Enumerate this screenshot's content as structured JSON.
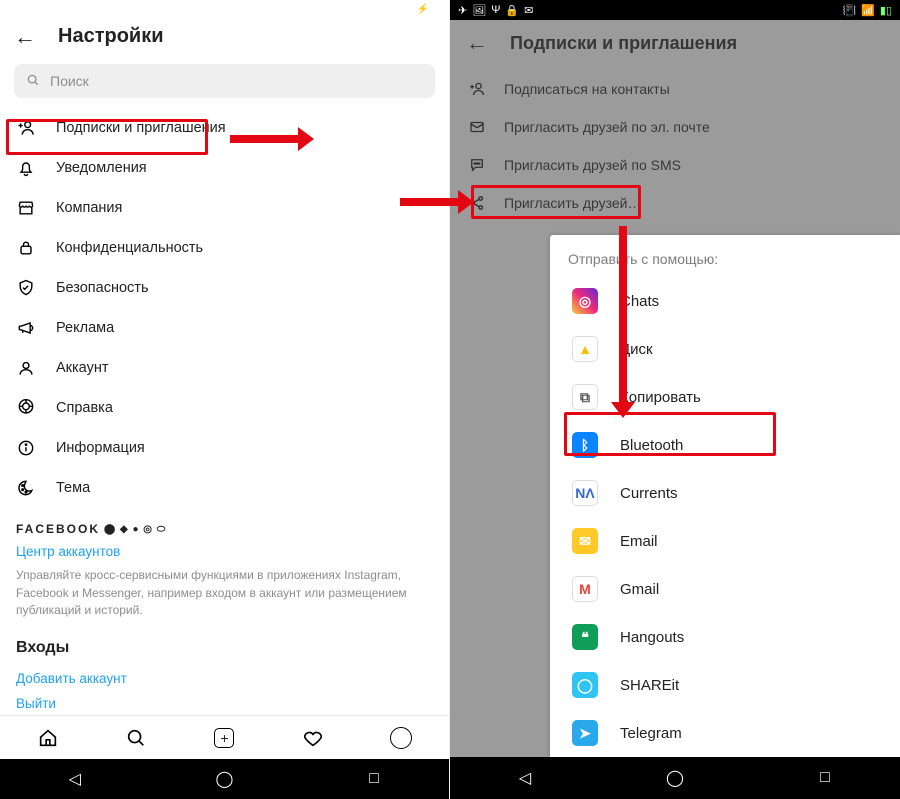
{
  "left": {
    "title": "Настройки",
    "search_placeholder": "Поиск",
    "menu": [
      {
        "icon": "add-person",
        "label": "Подписки и приглашения"
      },
      {
        "icon": "bell",
        "label": "Уведомления"
      },
      {
        "icon": "shop",
        "label": "Компания"
      },
      {
        "icon": "lock",
        "label": "Конфиденциальность"
      },
      {
        "icon": "shield",
        "label": "Безопасность"
      },
      {
        "icon": "megaphone",
        "label": "Реклама"
      },
      {
        "icon": "user",
        "label": "Аккаунт"
      },
      {
        "icon": "help",
        "label": "Справка"
      },
      {
        "icon": "info",
        "label": "Информация"
      },
      {
        "icon": "theme",
        "label": "Тема"
      }
    ],
    "facebook_label": "FACEBOOK",
    "account_center": "Центр аккаунтов",
    "account_desc": "Управляйте кросс-сервисными функциями в приложениях Instagram, Facebook и Messenger, например входом в аккаунт или размещением публикаций и историй.",
    "logins_title": "Входы",
    "add_account": "Добавить аккаунт",
    "logout": "Выйти"
  },
  "right": {
    "title": "Подписки и приглашения",
    "menu": [
      {
        "icon": "add-person",
        "label": "Подписаться на контакты"
      },
      {
        "icon": "mail",
        "label": "Пригласить друзей по эл. почте"
      },
      {
        "icon": "sms",
        "label": "Пригласить друзей по SMS"
      },
      {
        "icon": "share",
        "label": "Пригласить друзей…"
      }
    ],
    "sheet_title": "Отправить с помощью:",
    "apps": [
      {
        "name": "Chats",
        "iconbg": "linear-gradient(45deg,#f9ce34,#ee2a7b,#6228d7)",
        "sym": "◎"
      },
      {
        "name": "Диск",
        "iconbg": "#fff",
        "sym": "▲",
        "symcolor": "#fbbd05",
        "border": "1px solid #ddd"
      },
      {
        "name": "Копировать",
        "iconbg": "#fff",
        "sym": "⧉",
        "symcolor": "#555",
        "border": "1px solid #ddd"
      },
      {
        "name": "Bluetooth",
        "iconbg": "#0a84ff",
        "sym": "ᛒ"
      },
      {
        "name": "Currents",
        "iconbg": "#fff",
        "sym": "ΝΛ",
        "symcolor": "#3367d6",
        "border": "1px solid #ddd"
      },
      {
        "name": "Email",
        "iconbg": "#ffca28",
        "sym": "✉",
        "symcolor": "#fff"
      },
      {
        "name": "Gmail",
        "iconbg": "#fff",
        "sym": "M",
        "symcolor": "#ea4335",
        "border": "1px solid #ddd"
      },
      {
        "name": "Hangouts",
        "iconbg": "#0f9d58",
        "sym": "❝"
      },
      {
        "name": "SHAREit",
        "iconbg": "#2ec4f3",
        "sym": "◯"
      },
      {
        "name": "Telegram",
        "iconbg": "#29a9eb",
        "sym": "➤"
      }
    ]
  }
}
